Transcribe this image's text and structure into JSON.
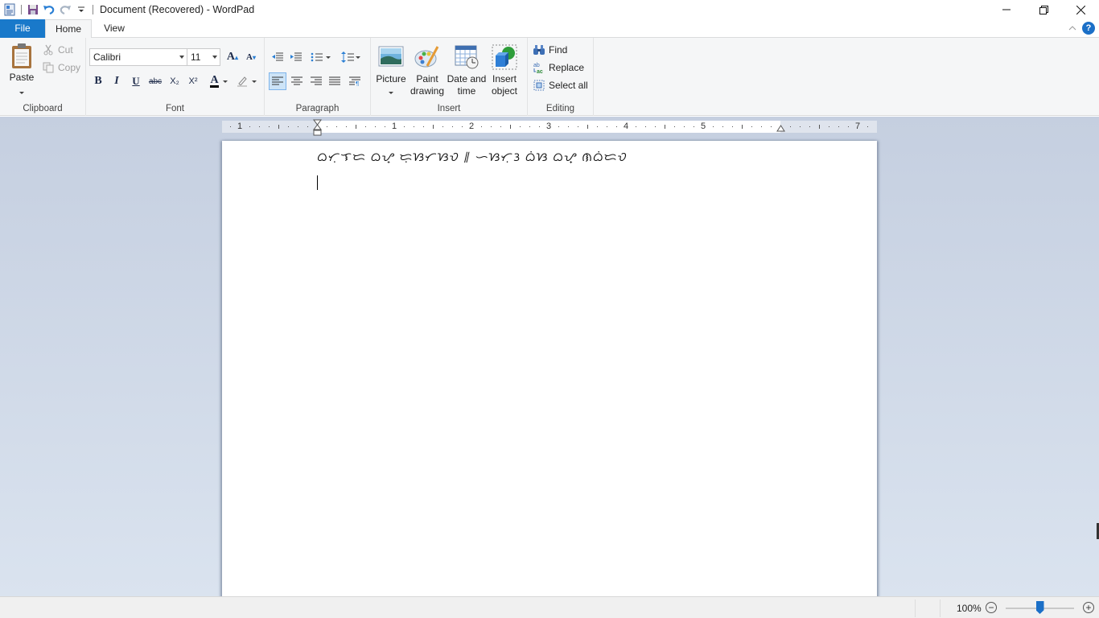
{
  "window": {
    "title": "Document (Recovered) - WordPad",
    "controls": {
      "minimize": "minimize",
      "restore": "restore",
      "close": "close"
    }
  },
  "quick_access": [
    {
      "name": "app-icon",
      "icon": "wordpad-icon"
    },
    {
      "name": "save",
      "icon": "save-icon"
    },
    {
      "name": "undo",
      "icon": "undo-icon"
    },
    {
      "name": "redo",
      "icon": "redo-icon"
    },
    {
      "name": "customize",
      "icon": "dropdown-icon"
    }
  ],
  "tabs": {
    "file": "File",
    "home": "Home",
    "view": "View"
  },
  "ribbon": {
    "clipboard": {
      "label": "Clipboard",
      "paste": "Paste",
      "cut": "Cut",
      "copy": "Copy"
    },
    "font": {
      "label": "Font",
      "family": "Calibri",
      "size": "11",
      "bold": "B",
      "italic": "I",
      "underline": "U",
      "strikethrough": "abc",
      "subscript": "X₂",
      "superscript": "X²",
      "font_color_glyph": "A",
      "font_color": "#000000",
      "grow_glyph": "A",
      "shrink_glyph": "A"
    },
    "paragraph": {
      "label": "Paragraph",
      "active_alignment": "left"
    },
    "insert": {
      "label": "Insert",
      "picture": "Picture",
      "paint_line1": "Paint",
      "paint_line2": "drawing",
      "date_line1": "Date and",
      "date_line2": "time",
      "object_line1": "Insert",
      "object_line2": "object"
    },
    "editing": {
      "label": "Editing",
      "find": "Find",
      "replace": "Replace",
      "select_all": "Select all"
    }
  },
  "ruler": {
    "labels": [
      "1",
      "1",
      "2",
      "3",
      "4",
      "5",
      "7"
    ],
    "units": "inches"
  },
  "document": {
    "lines": [
      "ᜊᜆᜓᜎᜇ ᜊᜌ᜔ ᜇᜓᜐᜆᜐᜏ ᜶ ᜑᜐᜆᜓᜂ ᜊᜒᜐ ᜊᜌ᜔ ᜈᜊᜒᜇᜏ",
      ""
    ]
  },
  "status": {
    "zoom": "100%",
    "zoom_out": "−",
    "zoom_in": "+",
    "zoom_fraction": 0.5
  },
  "colors": {
    "accent": "#1979ca",
    "workspace_top": "#c5cfe0",
    "workspace_bottom": "#dae3ef",
    "ribbon_bg": "#f5f6f7"
  }
}
